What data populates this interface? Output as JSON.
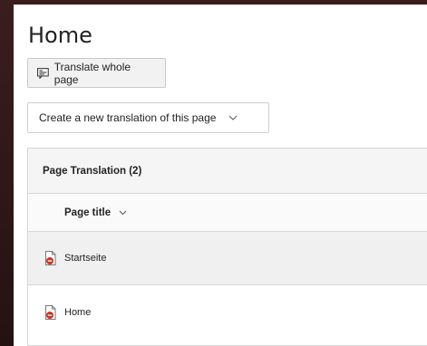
{
  "page": {
    "title": "Home"
  },
  "toolbar": {
    "translate_label": "Translate whole page",
    "translate_icon": "translate-page-icon"
  },
  "translation_select": {
    "selected": "Create a new translation of this page",
    "icon": "chevron-down-icon"
  },
  "translations_panel": {
    "heading": "Page Translation (2)",
    "column_header": "Page title",
    "rows": [
      {
        "title": "Startseite",
        "icon": "page-hidden-icon"
      },
      {
        "title": "Home",
        "icon": "page-hidden-icon"
      }
    ]
  },
  "colors": {
    "panel_bg": "#ffffff",
    "backdrop": "#2a1616",
    "border": "#d6d6d6",
    "icon_badge": "#c0392b"
  }
}
